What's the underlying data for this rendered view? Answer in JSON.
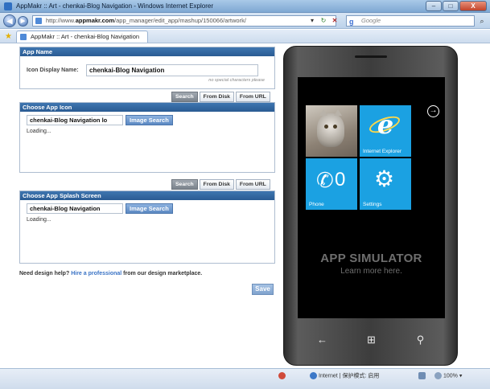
{
  "window": {
    "title": "AppMakr :: Art - chenkai-Blog Navigation - Windows Internet Explorer",
    "minimize": "–",
    "maximize": "□",
    "close": "X"
  },
  "nav": {
    "back_glyph": "◀",
    "forward_glyph": "▶",
    "url_prefix": "http://www.",
    "url_domain": "appmakr.com",
    "url_path": "/app_manager/edit_app/mashup/150066/artwork/",
    "refresh_glyph": "↻",
    "stop_glyph": "✕",
    "dropdown_glyph": "▾",
    "search_engine_glyph": "g",
    "search_placeholder": "Google",
    "search_go_glyph": "⌕"
  },
  "tabs": [
    {
      "label": "AppMakr :: Art - chenkai-Blog Navigation"
    }
  ],
  "favorites_glyph": "★",
  "app_name_panel": {
    "header": "App Name",
    "field_label": "Icon Display Name:",
    "field_value": "chenkai-Blog Navigation",
    "hint": "no special characters please"
  },
  "icon_buttons": [
    {
      "label": "Search",
      "active": true
    },
    {
      "label": "From Disk",
      "active": false
    },
    {
      "label": "From URL",
      "active": false
    }
  ],
  "icon_panel": {
    "header": "Choose App Icon",
    "search_value": "chenkai-Blog Navigation lo",
    "image_search_label": "Image Search",
    "loading": "Loading..."
  },
  "splash_buttons": [
    {
      "label": "Search",
      "active": true
    },
    {
      "label": "From Disk",
      "active": false
    },
    {
      "label": "From URL",
      "active": false
    }
  ],
  "splash_panel": {
    "header": "Choose App Splash Screen",
    "search_value": "chenkai-Blog Navigation",
    "image_search_label": "Image Search",
    "loading": "Loading..."
  },
  "design_help": {
    "prefix": "Need design help?",
    "link": "Hire a professional",
    "suffix": "from our design marketplace."
  },
  "save_label": "Save",
  "simulator": {
    "tiles": [
      {
        "label": "",
        "icon": "cat-photo"
      },
      {
        "label": "Internet Explorer",
        "icon": "ie-icon"
      },
      {
        "label": "Phone",
        "icon": "phone-icon",
        "count": "0"
      },
      {
        "label": "Settings",
        "icon": "gear-icon"
      }
    ],
    "ie_glyph": "e",
    "phone_glyph": "✆",
    "gear_glyph": "⚙",
    "arrow_glyph": "→",
    "title": "APP SIMULATOR",
    "subtitle": "Learn more here.",
    "back_key": "←",
    "start_key": "⊞",
    "search_key": "⚲",
    "tile_color": "#1ba1e2"
  },
  "status": {
    "zone": "Internet | 保护模式: 启用",
    "zoom": "100%",
    "zoom_dropdown": "▾"
  },
  "colors": {
    "panel_header": "#2a5b93",
    "link": "#3a73c5",
    "accent_blue": "#1ba1e2"
  }
}
